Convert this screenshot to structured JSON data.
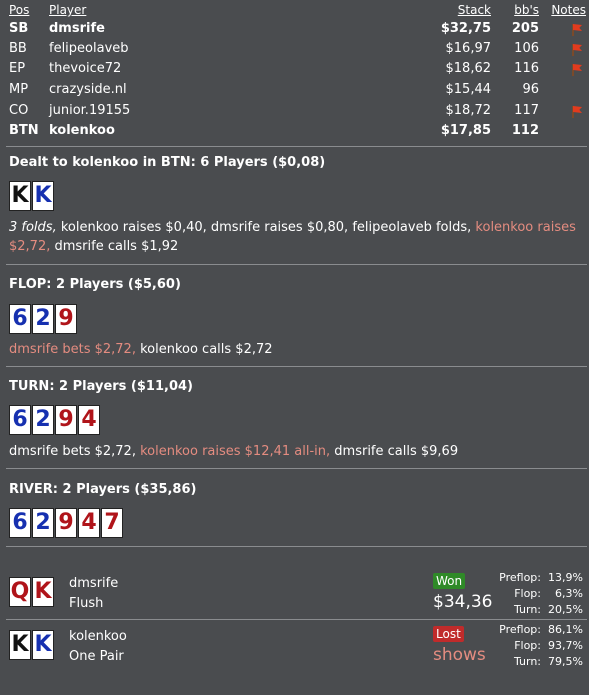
{
  "table": {
    "headers": {
      "pos": "Pos",
      "player": "Player",
      "stack": "Stack",
      "bbs": "bb's",
      "notes": "Notes"
    },
    "players": [
      {
        "pos": "SB",
        "name": "dmsrife",
        "stack": "$32,75",
        "bbs": "205",
        "note_flag": true,
        "bold": true
      },
      {
        "pos": "BB",
        "name": "felipeolaveb",
        "stack": "$16,97",
        "bbs": "106",
        "note_flag": true,
        "bold": false
      },
      {
        "pos": "EP",
        "name": "thevoice72",
        "stack": "$18,62",
        "bbs": "116",
        "note_flag": true,
        "bold": false
      },
      {
        "pos": "MP",
        "name": "crazyside.nl",
        "stack": "$15,44",
        "bbs": "96",
        "note_flag": false,
        "bold": false
      },
      {
        "pos": "CO",
        "name": "junior.19155",
        "stack": "$18,72",
        "bbs": "117",
        "note_flag": true,
        "bold": false
      },
      {
        "pos": "BTN",
        "name": "kolenkoo",
        "stack": "$17,85",
        "bbs": "112",
        "note_flag": false,
        "bold": true
      }
    ]
  },
  "preflop": {
    "title": "Dealt to kolenkoo in BTN: 6 Players ($0,08)",
    "cards": [
      {
        "rank": "K",
        "color": "black"
      },
      {
        "rank": "K",
        "color": "blue"
      }
    ],
    "a1": "3 folds,",
    "a2": " kolenkoo raises $0,40, dmsrife raises $0,80, felipeolaveb folds, ",
    "a3": "kolenkoo raises $2,72,",
    "a4": " dmsrife calls $1,92"
  },
  "flop": {
    "title": "FLOP: 2 Players ($5,60)",
    "cards": [
      {
        "rank": "6",
        "color": "blue"
      },
      {
        "rank": "2",
        "color": "blue"
      },
      {
        "rank": "9",
        "color": "red"
      }
    ],
    "a1": "dmsrife bets $2,72,",
    "a2": " kolenkoo calls $2,72"
  },
  "turn": {
    "title": "TURN: 2 Players ($11,04)",
    "cards": [
      {
        "rank": "6",
        "color": "blue"
      },
      {
        "rank": "2",
        "color": "blue"
      },
      {
        "rank": "9",
        "color": "red"
      },
      {
        "rank": "4",
        "color": "red"
      }
    ],
    "a1": "dmsrife bets $2,72, ",
    "a2": "kolenkoo raises $12,41 all-in,",
    "a3": " dmsrife calls $9,69"
  },
  "river": {
    "title": "RIVER: 2 Players ($35,86)",
    "cards": [
      {
        "rank": "6",
        "color": "blue"
      },
      {
        "rank": "2",
        "color": "blue"
      },
      {
        "rank": "9",
        "color": "red"
      },
      {
        "rank": "4",
        "color": "red"
      },
      {
        "rank": "7",
        "color": "red"
      }
    ]
  },
  "results": [
    {
      "name": "dmsrife",
      "hand": "Flush",
      "cards": [
        {
          "rank": "Q",
          "color": "red"
        },
        {
          "rank": "K",
          "color": "red"
        }
      ],
      "badge": "Won",
      "amount": "$34,36",
      "stats": [
        {
          "label": "Preflop:",
          "value": "13,9%"
        },
        {
          "label": "Flop:",
          "value": "6,3%"
        },
        {
          "label": "Turn:",
          "value": "20,5%"
        }
      ]
    },
    {
      "name": "kolenkoo",
      "hand": "One Pair",
      "cards": [
        {
          "rank": "K",
          "color": "black"
        },
        {
          "rank": "K",
          "color": "blue"
        }
      ],
      "badge": "Lost",
      "amount": "shows",
      "stats": [
        {
          "label": "Preflop:",
          "value": "86,1%"
        },
        {
          "label": "Flop:",
          "value": "93,7%"
        },
        {
          "label": "Turn:",
          "value": "79,5%"
        }
      ]
    }
  ]
}
